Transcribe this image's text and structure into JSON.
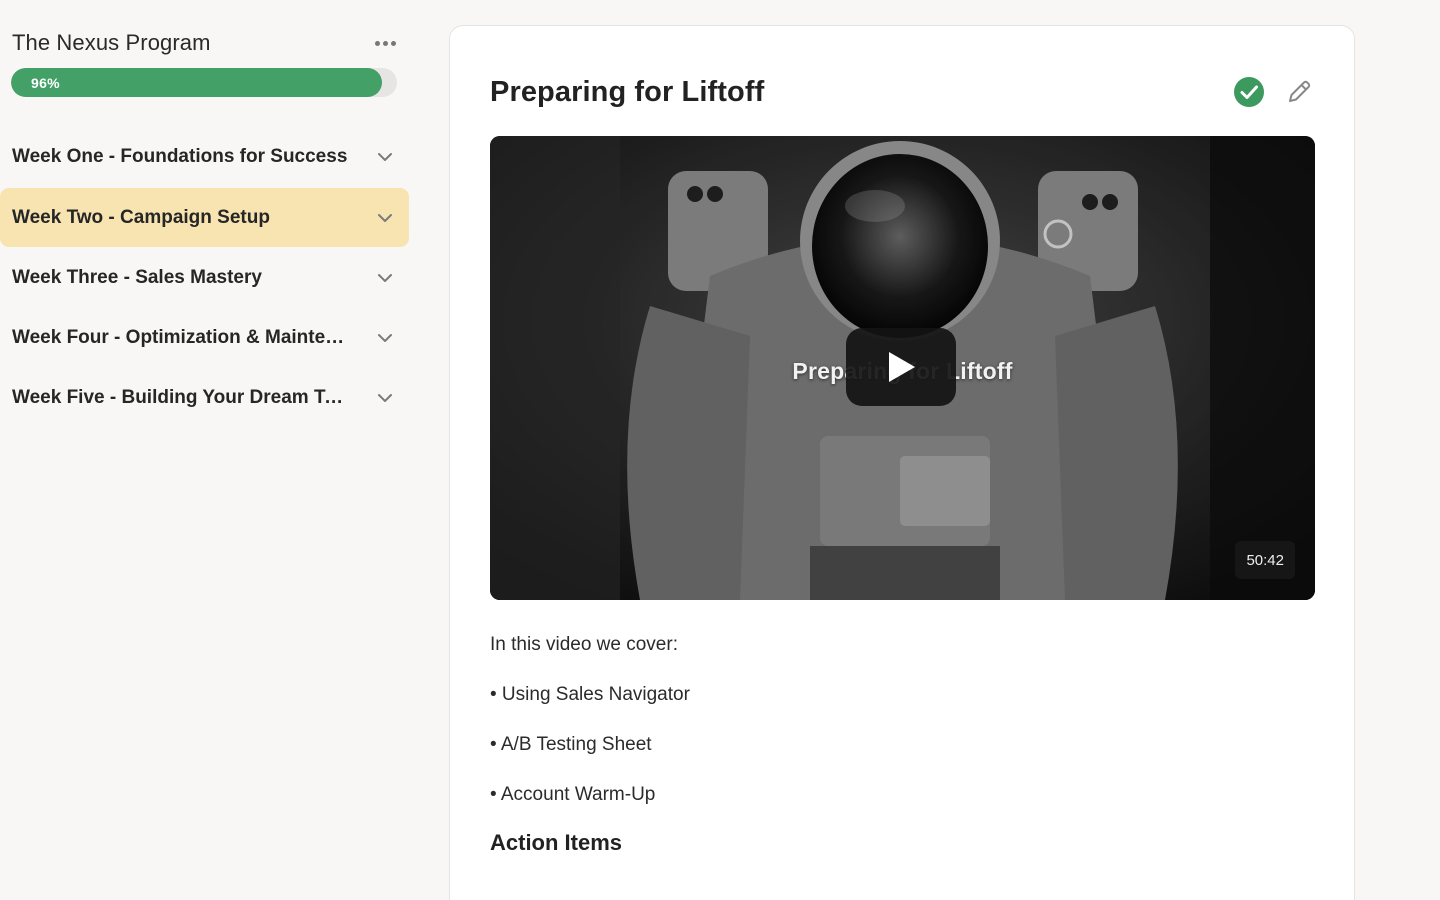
{
  "sidebar": {
    "program_title": "The Nexus Program",
    "menu_icon": "more-horizontal-icon",
    "progress": {
      "percent": 96,
      "label": "96%",
      "color": "#43a067"
    },
    "weeks": [
      {
        "label": "Week One - Foundations for Success",
        "active": false
      },
      {
        "label": "Week Two - Campaign Setup",
        "active": true
      },
      {
        "label": "Week Three - Sales Mastery",
        "active": false
      },
      {
        "label": "Week Four - Optimization & Maintenance",
        "active": false
      },
      {
        "label": "Week Five - Building Your Dream Team",
        "active": false
      }
    ]
  },
  "lesson": {
    "title": "Preparing for Liftoff",
    "status_icon": "check-circle-icon",
    "status_color": "#3c9a5f",
    "edit_icon": "pencil-icon",
    "video": {
      "caption": "Preparing for Liftoff",
      "duration": "50:42",
      "play_icon": "play-icon"
    },
    "intro": "In this video we cover:",
    "bullets": [
      "• Using Sales Navigator",
      "• A/B Testing Sheet",
      "• Account Warm-Up"
    ],
    "action_items_heading": "Action Items"
  },
  "colors": {
    "active_week_bg": "#f7e4b0",
    "page_bg": "#f8f7f5",
    "card_bg": "#ffffff"
  }
}
